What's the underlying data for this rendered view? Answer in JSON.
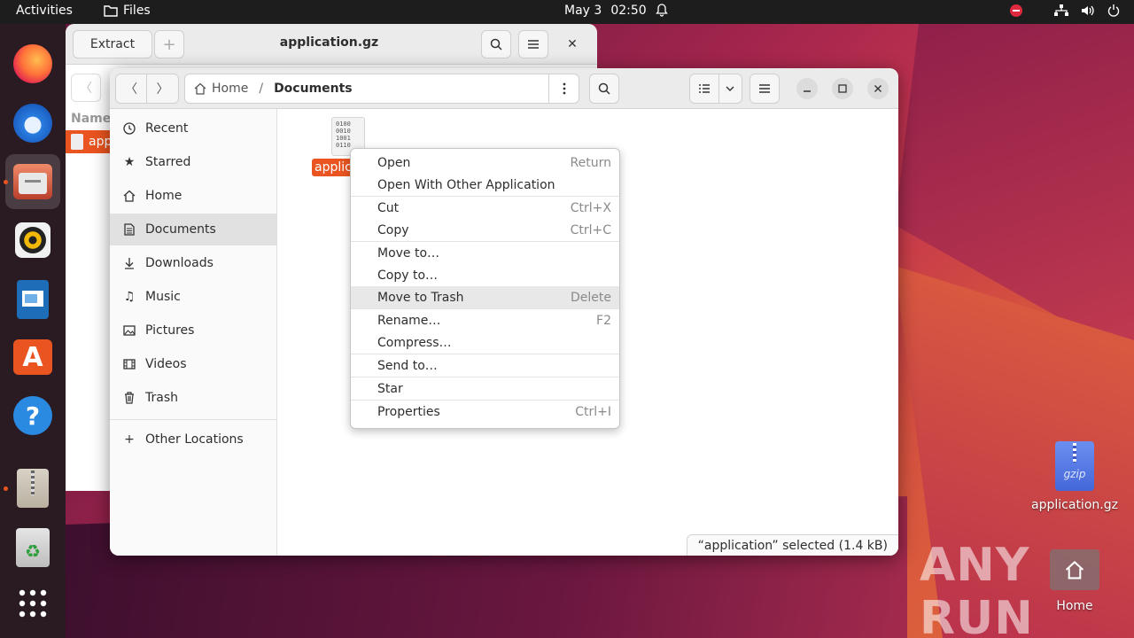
{
  "topbar": {
    "activities": "Activities",
    "app_name": "Files",
    "date": "May 3",
    "time": "02:50"
  },
  "dock": {
    "items": [
      "firefox-icon",
      "thunderbird-icon",
      "files-icon",
      "rhythmbox-icon",
      "writer-icon",
      "software-icon",
      "help-icon",
      "archive-manager-icon",
      "trash-icon",
      "apps-grid-icon"
    ]
  },
  "archive_window": {
    "extract_label": "Extract",
    "title": "application.gz",
    "column_name": "Name",
    "row_label": "app"
  },
  "files_window": {
    "path": [
      "Home",
      "Documents"
    ],
    "sidebar": [
      {
        "label": "Recent",
        "icon": "clock-icon"
      },
      {
        "label": "Starred",
        "icon": "star-icon"
      },
      {
        "label": "Home",
        "icon": "home-icon"
      },
      {
        "label": "Documents",
        "icon": "document-icon"
      },
      {
        "label": "Downloads",
        "icon": "download-icon"
      },
      {
        "label": "Music",
        "icon": "music-icon"
      },
      {
        "label": "Pictures",
        "icon": "picture-icon"
      },
      {
        "label": "Videos",
        "icon": "video-icon"
      },
      {
        "label": "Trash",
        "icon": "trash-icon"
      },
      {
        "label": "Other Locations",
        "icon": "plus-icon"
      }
    ],
    "file_label": "applic",
    "file_icon_text": [
      "0100",
      "0010",
      "1001",
      "0110"
    ],
    "status": "“application” selected  (1.4 kB)"
  },
  "context_menu": {
    "items": [
      {
        "label": "Open",
        "accel": "Return"
      },
      {
        "label": "Open With Other Application",
        "accel": ""
      },
      {
        "label": "Cut",
        "accel": "Ctrl+X"
      },
      {
        "label": "Copy",
        "accel": "Ctrl+C"
      },
      {
        "label": "Move to…",
        "accel": ""
      },
      {
        "label": "Copy to…",
        "accel": ""
      },
      {
        "label": "Move to Trash",
        "accel": "Delete"
      },
      {
        "label": "Rename…",
        "accel": "F2"
      },
      {
        "label": "Compress…",
        "accel": ""
      },
      {
        "label": "Send to…",
        "accel": ""
      },
      {
        "label": "Star",
        "accel": ""
      },
      {
        "label": "Properties",
        "accel": "Ctrl+I"
      }
    ]
  },
  "desktop": {
    "archive_label": "application.gz",
    "archive_badge": "gzip",
    "home_label": "Home",
    "watermark": "ANY RUN"
  },
  "colors": {
    "accent": "#e95420",
    "topbar": "#1d1d1d"
  }
}
